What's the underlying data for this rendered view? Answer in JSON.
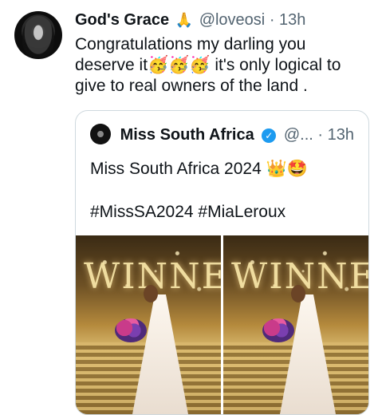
{
  "tweet": {
    "author_name": "God's Grace",
    "name_emoji": "🙏",
    "handle": "@loveosi",
    "separator": "·",
    "time": "13h",
    "text": "Congratulations my darling you deserve it🥳🥳🥳 it's only logical to give to real owners of the land ."
  },
  "quote": {
    "author_name": "Miss South Africa",
    "verified_glyph": "✓",
    "handle": "@...",
    "separator": "·",
    "time": "13h",
    "text": "Miss South Africa 2024 👑🤩",
    "hashtags": "#MissSA2024 #MiaLeroux",
    "photos": [
      {
        "alt_word": "WINNE"
      },
      {
        "alt_word": "WINNE"
      }
    ]
  },
  "colors": {
    "text": "#0f1419",
    "muted": "#536471",
    "border": "#cfd9de",
    "verified": "#1d9bf0"
  }
}
